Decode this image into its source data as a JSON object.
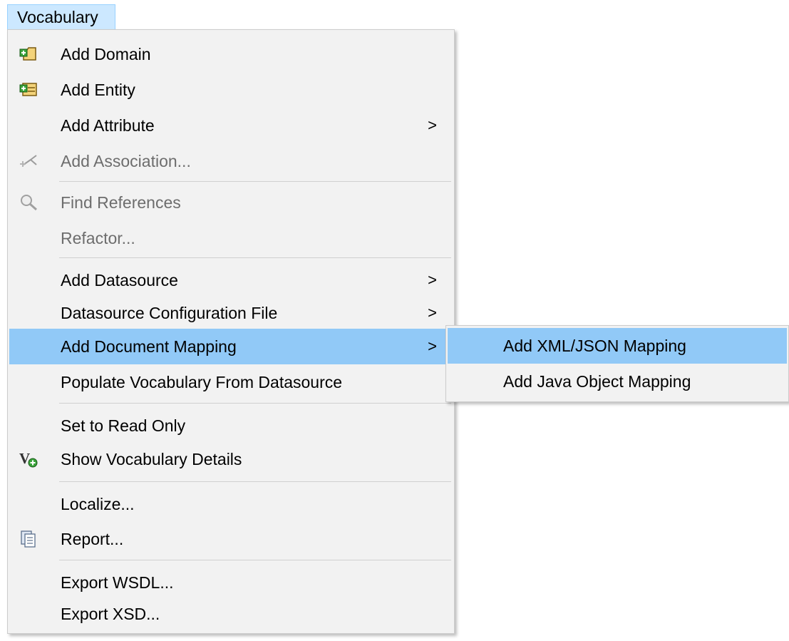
{
  "menubar": {
    "title": "Vocabulary"
  },
  "menu": {
    "items": [
      {
        "label": "Add Domain",
        "icon": "add-domain-icon"
      },
      {
        "label": "Add Entity",
        "icon": "add-entity-icon"
      },
      {
        "label": "Add Attribute",
        "submenu_arrow": ">"
      },
      {
        "label": "Add Association...",
        "icon": "add-association-icon",
        "disabled": true
      },
      {
        "label": "Find References",
        "icon": "magnifier-icon",
        "disabled": true
      },
      {
        "label": "Refactor...",
        "disabled": true
      },
      {
        "label": "Add Datasource",
        "submenu_arrow": ">"
      },
      {
        "label": "Datasource Configuration File",
        "submenu_arrow": ">"
      },
      {
        "label": "Add Document Mapping",
        "submenu_arrow": ">",
        "highlighted": true
      },
      {
        "label": "Populate Vocabulary From Datasource"
      },
      {
        "label": "Set to Read Only"
      },
      {
        "label": "Show Vocabulary Details",
        "icon": "vocabulary-details-icon"
      },
      {
        "label": "Localize..."
      },
      {
        "label": "Report...",
        "icon": "report-icon"
      },
      {
        "label": "Export WSDL..."
      },
      {
        "label": "Export XSD..."
      }
    ]
  },
  "submenu": {
    "items": [
      {
        "label": "Add XML/JSON Mapping",
        "highlighted": true
      },
      {
        "label": "Add Java Object Mapping"
      }
    ]
  },
  "colors": {
    "menu_background": "#f2f2f2",
    "highlight": "#91c9f7",
    "menubar_selected": "#cce8ff",
    "disabled_text": "#6d6d6d"
  }
}
